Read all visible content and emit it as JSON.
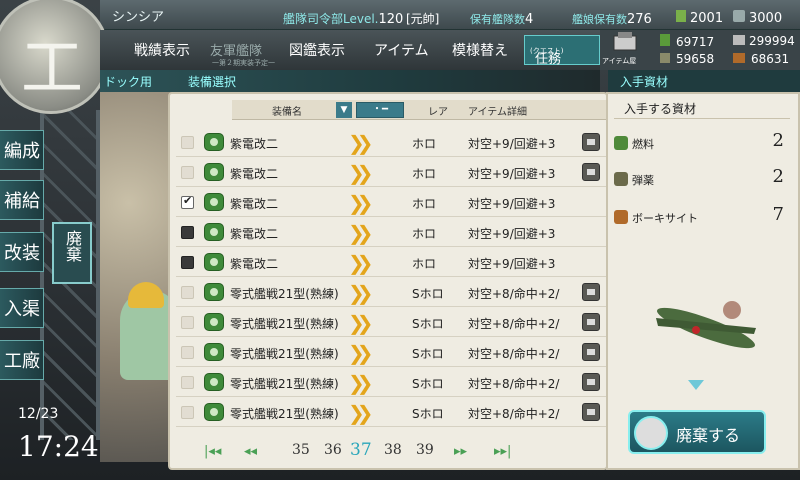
{
  "header": {
    "name": "シンシア",
    "hq_label": "艦隊司令部Level.",
    "hq_level": "120",
    "rank": "[元帥]",
    "ships_label": "保有艦隊数",
    "ships": "4",
    "girls_label": "艦娘保有数",
    "girls": "276",
    "buckets": "2001",
    "devmat": "3000"
  },
  "menu": {
    "record": "戦績表示",
    "friend": "友軍艦隊",
    "friend_sub": "一第２期実装予定一",
    "library": "図鑑表示",
    "item": "アイテム",
    "remodel": "模様替え",
    "quest": "任務",
    "quest_sub": "(クエスト)",
    "shop": "アイテム屋"
  },
  "resources": {
    "fuel": "69717",
    "steel": "299994",
    "ammo": "59658",
    "bauxite": "68631"
  },
  "breadcrumb": {
    "dock": "ドック用",
    "equip": "装備選択",
    "gain": "入手資材"
  },
  "left_nav": [
    "編成",
    "補給",
    "改装",
    "入渠",
    "工廠"
  ],
  "dev_label": "廃棄",
  "datetime": {
    "date": "12/23",
    "time": "17:24"
  },
  "table": {
    "col_name": "装備名",
    "col_rare": "レア",
    "col_detail": "アイテム詳細",
    "filter_label": "・━",
    "rows": [
      {
        "name": "紫電改二",
        "rare": "ホロ",
        "stat": "対空+9/回避+3",
        "check": "empty",
        "lock": true
      },
      {
        "name": "紫電改二",
        "rare": "ホロ",
        "stat": "対空+9/回避+3",
        "check": "empty",
        "lock": true
      },
      {
        "name": "紫電改二",
        "rare": "ホロ",
        "stat": "対空+9/回避+3",
        "check": "checked",
        "lock": false
      },
      {
        "name": "紫電改二",
        "rare": "ホロ",
        "stat": "対空+9/回避+3",
        "check": "dark",
        "lock": false
      },
      {
        "name": "紫電改二",
        "rare": "ホロ",
        "stat": "対空+9/回避+3",
        "check": "dark",
        "lock": false
      },
      {
        "name": "零式艦戦21型(熟練)",
        "rare": "Sホロ",
        "stat": "対空+8/命中+2/",
        "check": "empty",
        "lock": true
      },
      {
        "name": "零式艦戦21型(熟練)",
        "rare": "Sホロ",
        "stat": "対空+8/命中+2/",
        "check": "empty",
        "lock": true
      },
      {
        "name": "零式艦戦21型(熟練)",
        "rare": "Sホロ",
        "stat": "対空+8/命中+2/",
        "check": "empty",
        "lock": true
      },
      {
        "name": "零式艦戦21型(熟練)",
        "rare": "Sホロ",
        "stat": "対空+8/命中+2/",
        "check": "empty",
        "lock": true
      },
      {
        "name": "零式艦戦21型(熟練)",
        "rare": "Sホロ",
        "stat": "対空+8/命中+2/",
        "check": "empty",
        "lock": true
      }
    ]
  },
  "pager": {
    "pages": [
      "35",
      "36",
      "37",
      "38",
      "39"
    ],
    "current": "37"
  },
  "gain_panel": {
    "title": "入手する資材",
    "items": [
      {
        "name": "燃料",
        "value": "2",
        "color": "#4f8a3a"
      },
      {
        "name": "弾薬",
        "value": "2",
        "color": "#6b6a4a"
      },
      {
        "name": "ボーキサイト",
        "value": "7",
        "color": "#b06a2a"
      }
    ],
    "scrap_button": "廃棄する"
  }
}
